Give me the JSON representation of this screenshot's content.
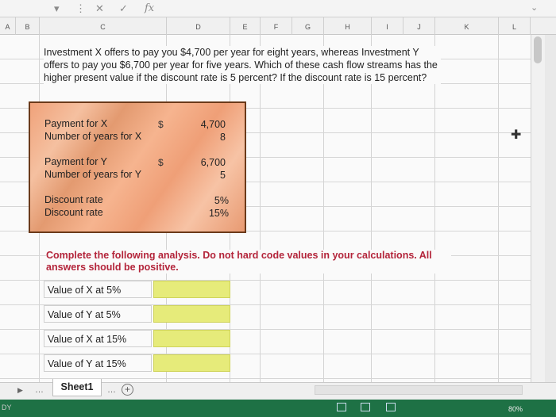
{
  "toolbar": {
    "undo_icon": "cancel-x-icon",
    "check_icon": "check-icon",
    "fx_label": "fx"
  },
  "columns": [
    "A",
    "B",
    "C",
    "D",
    "E",
    "F",
    "G",
    "H",
    "I",
    "J",
    "K",
    "L"
  ],
  "problem_text": "Investment X offers to pay you $4,700 per year for eight years, whereas Investment Y offers to pay you $6,700 per year for five years. Which of these cash flow streams has the higher present value if the discount rate is 5 percent? If the discount rate is 15 percent?",
  "inputs": {
    "payment_x_label": "Payment for X",
    "years_x_label": "Number of years for X",
    "payment_y_label": "Payment for Y",
    "years_y_label": "Number of years for Y",
    "discount1_label": "Discount rate",
    "discount2_label": "Discount rate",
    "currency": "$",
    "payment_x": "4,700",
    "years_x": "8",
    "payment_y": "6,700",
    "years_y": "5",
    "discount1": "5%",
    "discount2": "15%"
  },
  "instruction": "Complete the following analysis. Do not hard code values in your calculations. All answers should be positive.",
  "questions": [
    "Value of X at 5%",
    "Value of Y at 5%",
    "Value of X at 15%",
    "Value of Y at 15%"
  ],
  "sheet_tab": "Sheet1",
  "status": {
    "left": "DY",
    "zoom": "80%"
  },
  "colors": {
    "input_fill": "#f0a27a",
    "input_border": "#6b3a1a",
    "answer_fill": "#e6eb7a",
    "instruction_red": "#b3243a",
    "status_green": "#1e7145"
  }
}
